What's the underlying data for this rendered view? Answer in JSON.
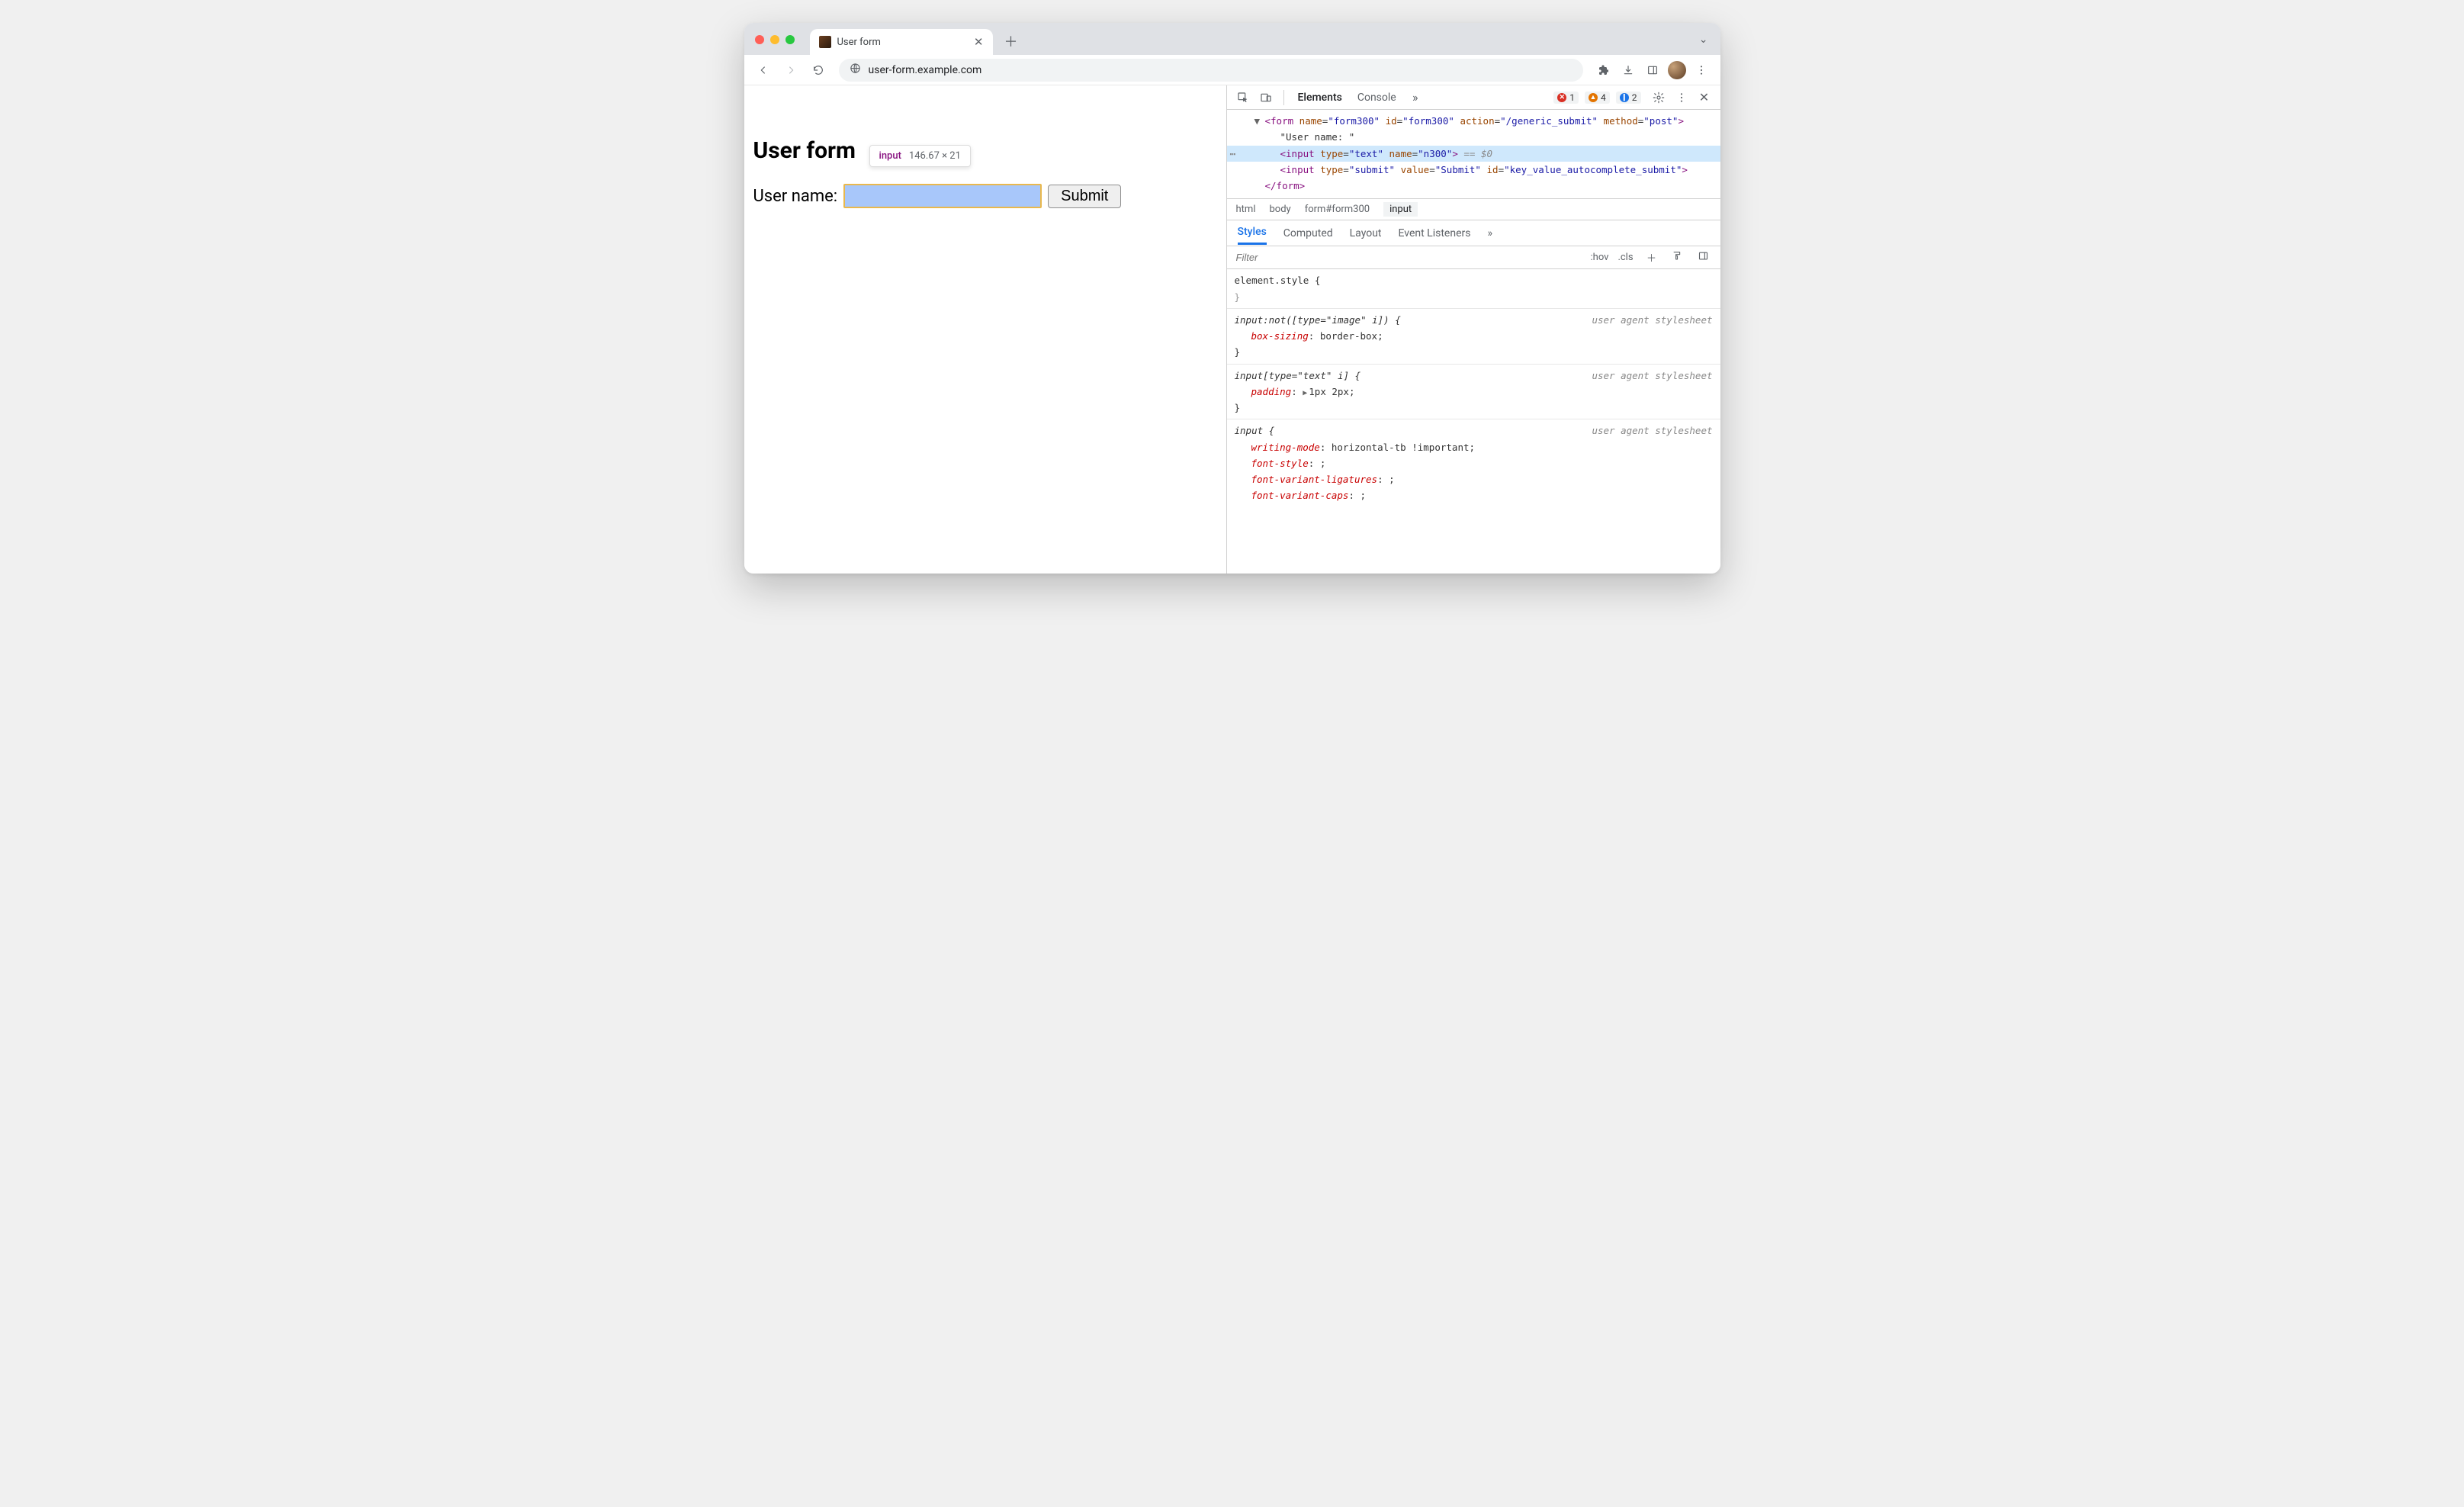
{
  "tab": {
    "title": "User form"
  },
  "omnibox": {
    "url": "user-form.example.com"
  },
  "page": {
    "heading": "User form",
    "username_label": "User name:",
    "submit_label": "Submit"
  },
  "inspect_tooltip": {
    "tag": "input",
    "dims": "146.67 × 21"
  },
  "devtools": {
    "tabs": {
      "elements": "Elements",
      "console": "Console"
    },
    "badges": {
      "errors": "1",
      "warnings": "4",
      "info": "2"
    },
    "dom": {
      "form_open": "<form name=\"form300\" id=\"form300\" action=\"/generic_submit\" method=\"post\">",
      "text_node": "\"User name: \"",
      "input_text": "<input type=\"text\" name=\"n300\">",
      "eq0": " == $0",
      "input_submit": "<input type=\"submit\" value=\"Submit\" id=\"key_value_autocomplete_submit\">",
      "form_close": "</form>"
    },
    "crumbs": {
      "c0": "html",
      "c1": "body",
      "c2": "form#form300",
      "c3": "input"
    },
    "subtabs": {
      "styles": "Styles",
      "computed": "Computed",
      "layout": "Layout",
      "listeners": "Event Listeners"
    },
    "filter": {
      "placeholder": "Filter",
      "hov": ":hov",
      "cls": ".cls"
    },
    "rules": {
      "r0_sel": "element.style {",
      "r1_sel": "input:not([type=\"image\" i]) {",
      "r1_origin": "user agent stylesheet",
      "r1_p0": "box-sizing",
      "r1_v0": "border-box",
      "r2_sel": "input[type=\"text\" i] {",
      "r2_origin": "user agent stylesheet",
      "r2_p0": "padding",
      "r2_v0": "1px 2px",
      "r3_sel": "input {",
      "r3_origin": "user agent stylesheet",
      "r3_p0": "writing-mode",
      "r3_v0": "horizontal-tb !important",
      "r3_p1": "font-style",
      "r3_v1": "",
      "r3_p2": "font-variant-ligatures",
      "r3_v2": "",
      "r3_p3": "font-variant-caps",
      "r3_v3": ""
    }
  }
}
